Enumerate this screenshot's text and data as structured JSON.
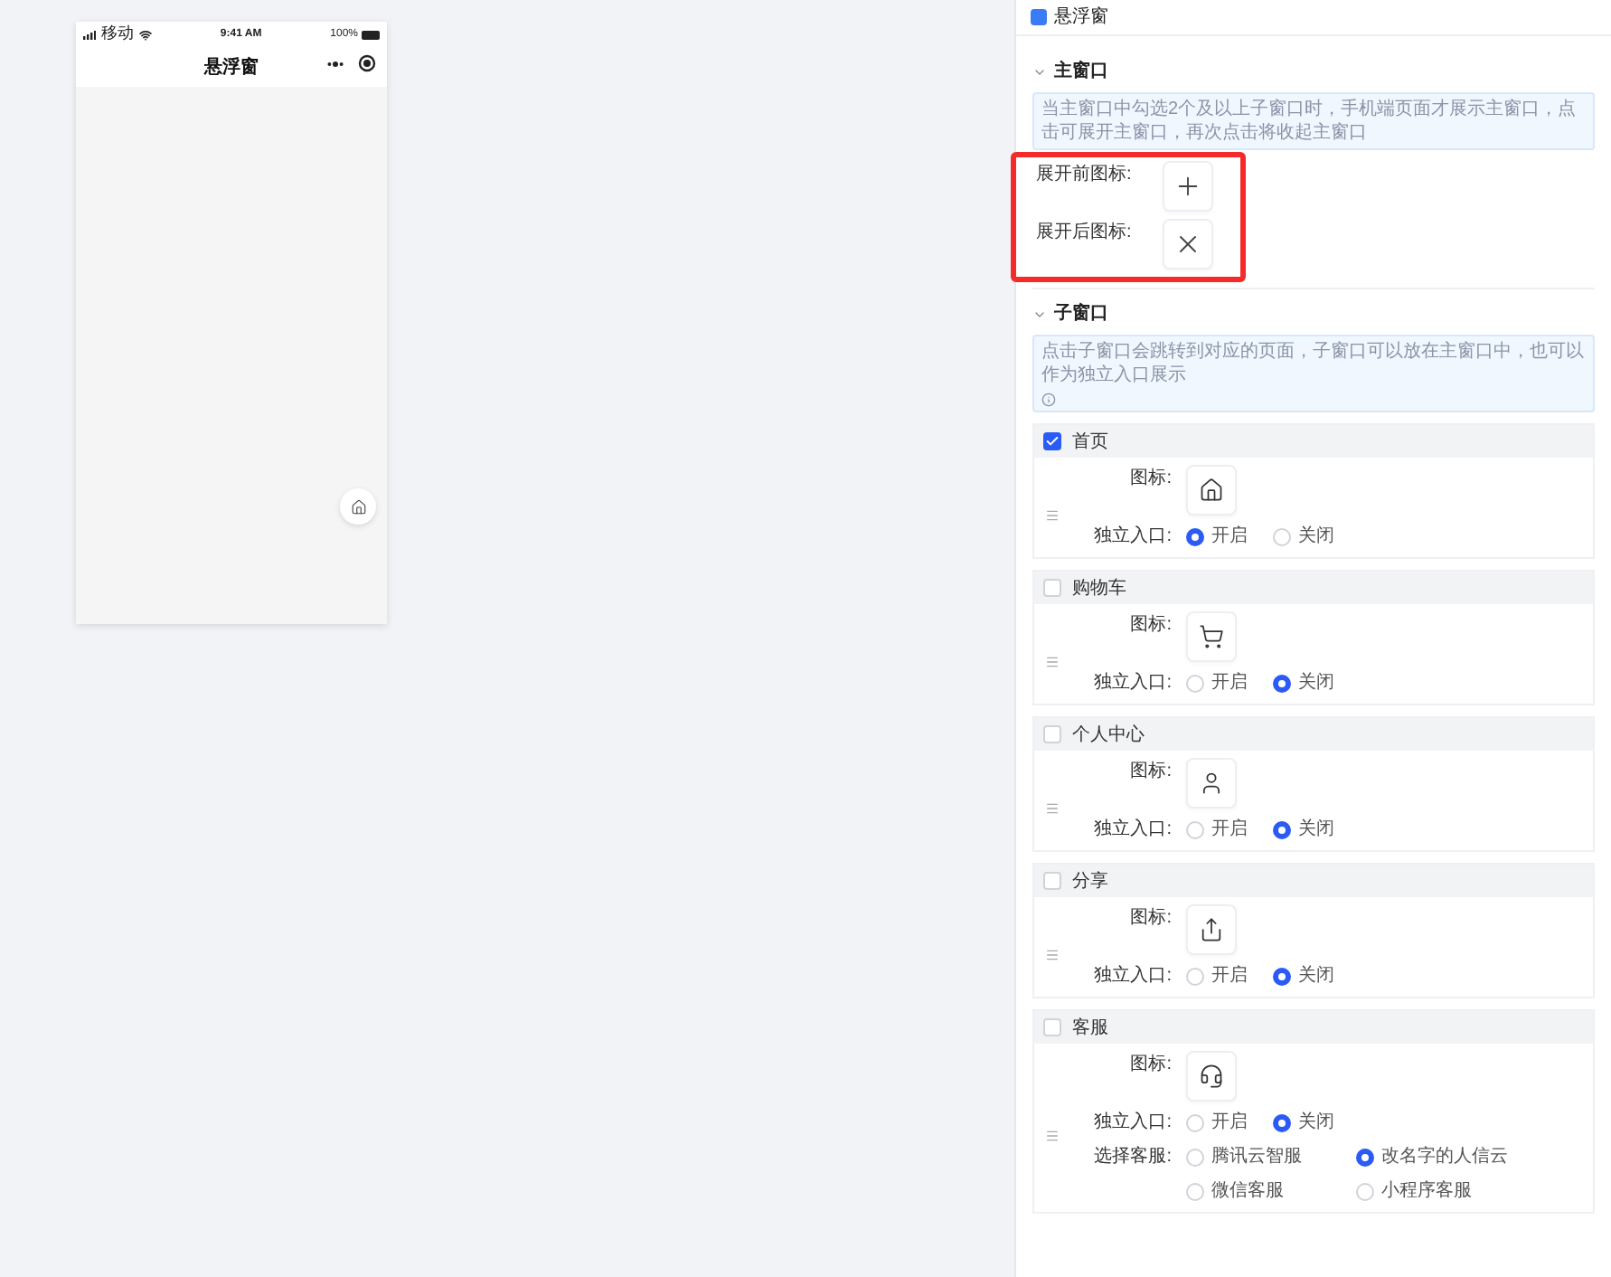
{
  "phone": {
    "carrier": "移动",
    "time": "9:41 AM",
    "battery": "100%",
    "title": "悬浮窗"
  },
  "panel": {
    "title": "悬浮窗",
    "main_window": {
      "title": "主窗口",
      "note": "当主窗口中勾选2个及以上子窗口时，手机端页面才展示主窗口，点击可展开主窗口，再次点击将收起主窗口",
      "before_label": "展开前图标:",
      "after_label": "展开后图标:"
    },
    "sub_window": {
      "title": "子窗口",
      "note": "点击子窗口会跳转到对应的页面，子窗口可以放在主窗口中，也可以作为独立入口展示",
      "items": [
        {
          "kind": "home",
          "name": "首页",
          "checked": true,
          "icon_label": "图标:",
          "entry_label": "独立入口:",
          "options": [
            {
              "label": "开启",
              "selected": true
            },
            {
              "label": "关闭",
              "selected": false
            }
          ]
        },
        {
          "kind": "cart",
          "name": "购物车",
          "checked": false,
          "icon_label": "图标:",
          "entry_label": "独立入口:",
          "options": [
            {
              "label": "开启",
              "selected": false
            },
            {
              "label": "关闭",
              "selected": true
            }
          ]
        },
        {
          "kind": "user",
          "name": "个人中心",
          "checked": false,
          "icon_label": "图标:",
          "entry_label": "独立入口:",
          "options": [
            {
              "label": "开启",
              "selected": false
            },
            {
              "label": "关闭",
              "selected": true
            }
          ]
        },
        {
          "kind": "share",
          "name": "分享",
          "checked": false,
          "icon_label": "图标:",
          "entry_label": "独立入口:",
          "options": [
            {
              "label": "开启",
              "selected": false
            },
            {
              "label": "关闭",
              "selected": true
            }
          ]
        },
        {
          "kind": "service",
          "name": "客服",
          "checked": false,
          "icon_label": "图标:",
          "entry_label": "独立入口:",
          "options": [
            {
              "label": "开启",
              "selected": false
            },
            {
              "label": "关闭",
              "selected": true
            }
          ],
          "service_label": "选择客服:",
          "service_options": [
            {
              "label": "腾讯云智服",
              "selected": false
            },
            {
              "label": "改名字的人信云",
              "selected": true
            },
            {
              "label": "微信客服",
              "selected": false
            },
            {
              "label": "小程序客服",
              "selected": false
            }
          ]
        }
      ]
    }
  }
}
